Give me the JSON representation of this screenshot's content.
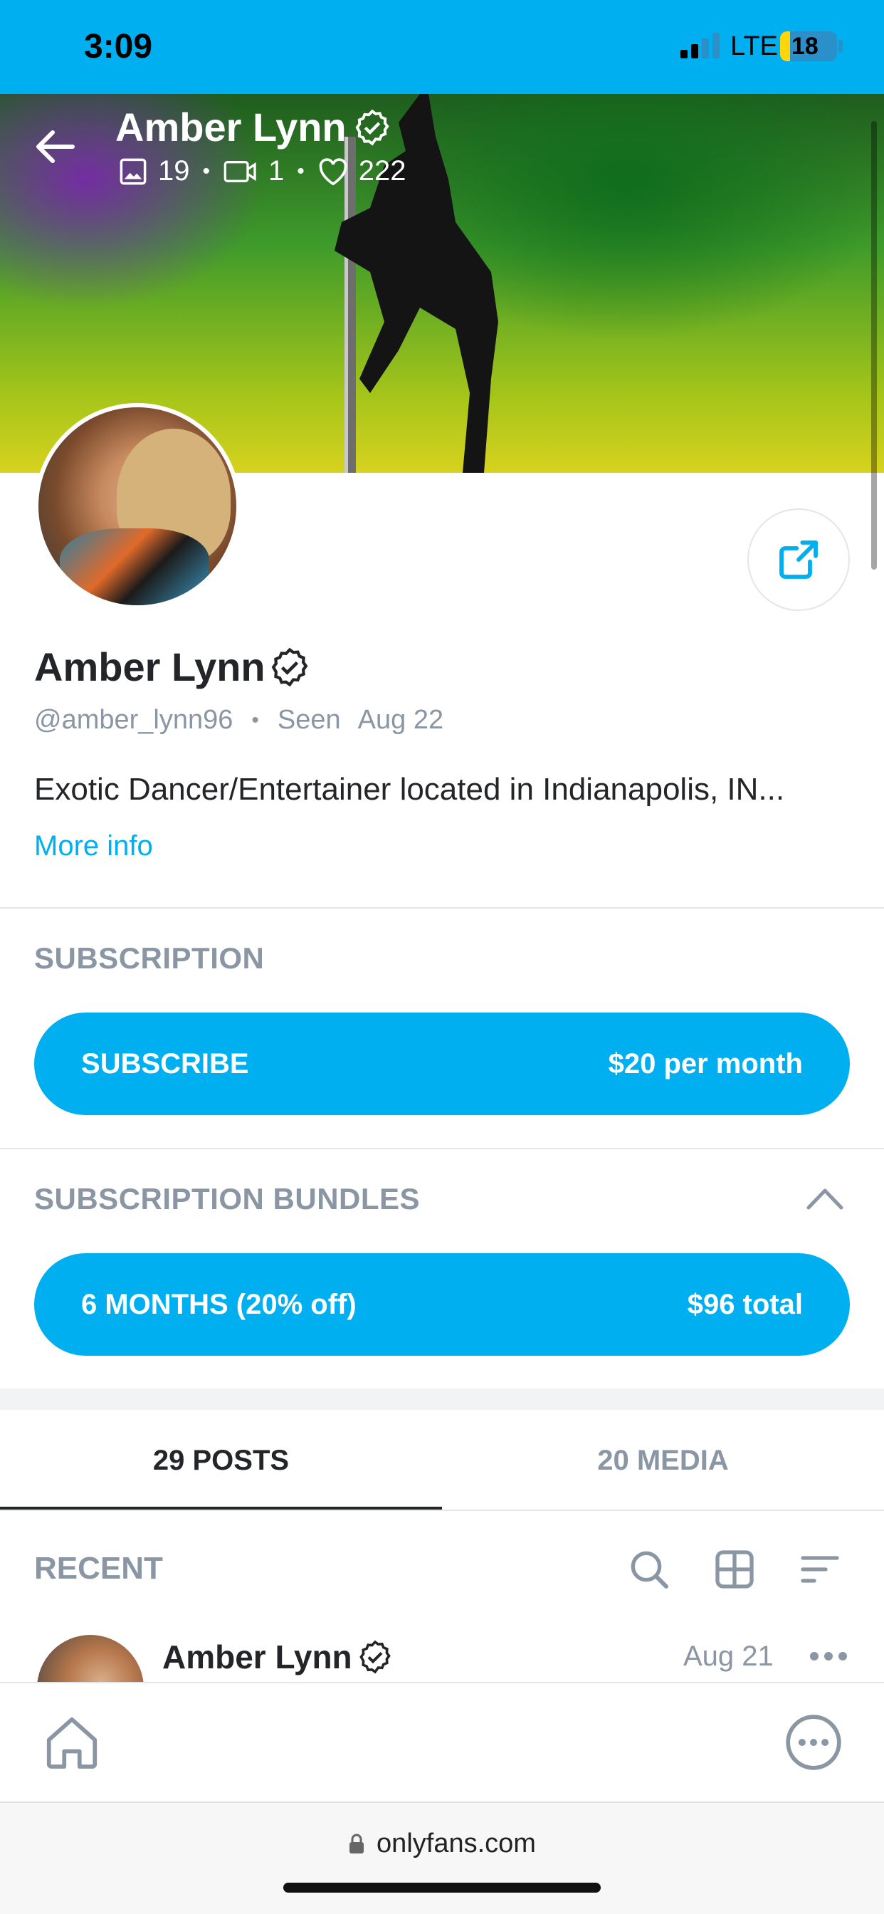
{
  "status_bar": {
    "time": "3:09",
    "network": "LTE",
    "battery": "18",
    "battery_level": 0.18
  },
  "header": {
    "title": "Amber Lynn",
    "photos_count": "19",
    "videos_count": "1",
    "likes_count": "222",
    "separator": "•"
  },
  "profile": {
    "name": "Amber Lynn",
    "handle": "@amber_lynn96",
    "separator": "•",
    "seen_label": "Seen",
    "seen_date": "Aug 22",
    "bio": "Exotic Dancer/Entertainer located in Indianapolis, IN...",
    "more_info": "More info"
  },
  "subscription": {
    "heading": "SUBSCRIPTION",
    "button_label": "SUBSCRIBE",
    "price": "$20 per month"
  },
  "bundles": {
    "heading": "SUBSCRIPTION BUNDLES",
    "bundle_label": "6 MONTHS (20% off)",
    "bundle_price": "$96 total"
  },
  "tabs": [
    {
      "label": "29 POSTS",
      "active": true
    },
    {
      "label": "20 MEDIA",
      "active": false
    }
  ],
  "feed": {
    "heading": "RECENT",
    "post_author": "Amber Lynn",
    "post_date": "Aug 21"
  },
  "browser": {
    "url": "onlyfans.com"
  },
  "colors": {
    "accent": "#00aff0",
    "muted": "#8a96a3",
    "text": "#242529"
  }
}
